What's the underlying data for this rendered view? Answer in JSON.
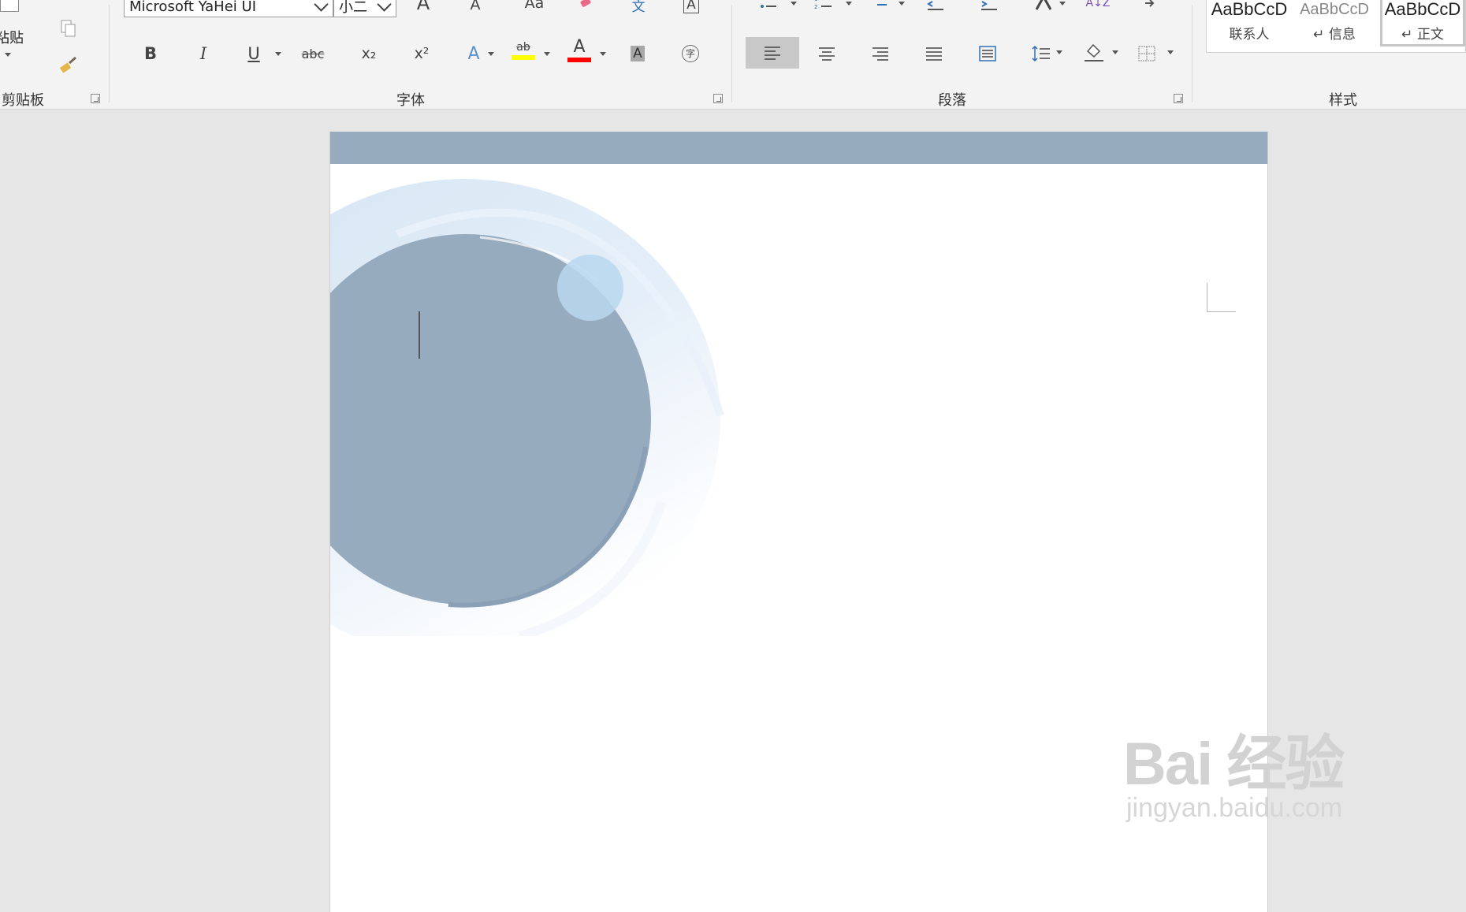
{
  "clipboard": {
    "paste_label": "粘贴",
    "group_label": "剪贴板"
  },
  "font": {
    "font_name": "Microsoft YaHei UI",
    "font_size": "小二",
    "grow_label": "A",
    "shrink_label": "A",
    "change_case_label": "Aa",
    "phonetic_label": "文",
    "border_char_label": "A",
    "bold_label": "B",
    "italic_label": "I",
    "underline_label": "U",
    "strike_label": "abc",
    "subscript_label": "x₂",
    "superscript_label": "x²",
    "text_effect_label": "A",
    "highlight_label": "ab",
    "font_color_label": "A",
    "char_shading_label": "A",
    "enclose_label": "字",
    "group_label": "字体"
  },
  "paragraph": {
    "group_label": "段落",
    "sort_label": "A↓Z"
  },
  "styles": {
    "group_label": "样式",
    "items": [
      {
        "sample": "AaBbCcD",
        "name": "联系人"
      },
      {
        "sample": "AaBbCcD",
        "name": "↵ 信息"
      },
      {
        "sample": "AaBbCcD",
        "name": "↵ 正文"
      }
    ]
  },
  "watermark": {
    "logo": "Bai 经验",
    "url": "jingyan.baidu.com"
  },
  "colors": {
    "header_band": "#97abbf",
    "circle_fill": "#97abbf",
    "halo": "#dbe8f4",
    "small_circle": "#b9d7ee",
    "highlight_yellow": "#ffff00",
    "font_red": "#ff0000"
  }
}
